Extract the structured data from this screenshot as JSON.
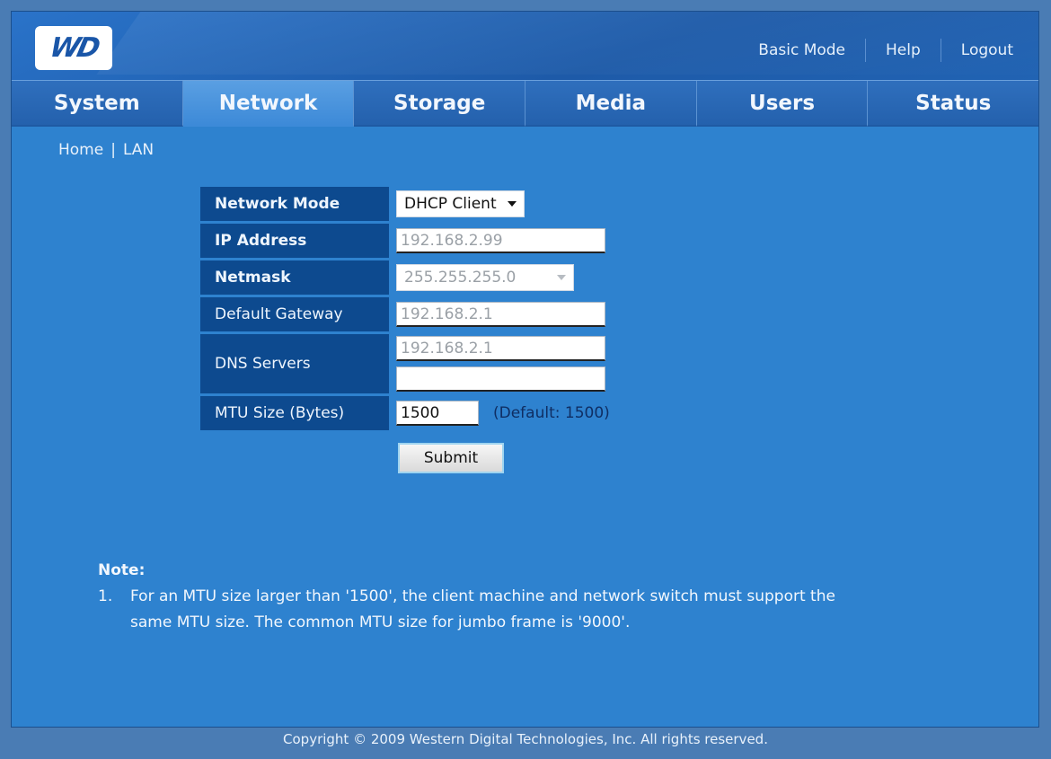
{
  "header": {
    "logo_text": "WD",
    "links": [
      "Basic Mode",
      "Help",
      "Logout"
    ]
  },
  "tabs": [
    {
      "label": "System",
      "active": false
    },
    {
      "label": "Network",
      "active": true
    },
    {
      "label": "Storage",
      "active": false
    },
    {
      "label": "Media",
      "active": false
    },
    {
      "label": "Users",
      "active": false
    },
    {
      "label": "Status",
      "active": false
    }
  ],
  "breadcrumb": {
    "home": "Home",
    "separator": "|",
    "current": "LAN"
  },
  "form": {
    "network_mode": {
      "label": "Network Mode",
      "value": "DHCP Client"
    },
    "ip_address": {
      "label": "IP Address",
      "value": "192.168.2.99"
    },
    "netmask": {
      "label": "Netmask",
      "value": "255.255.255.0"
    },
    "gateway": {
      "label": "Default Gateway",
      "value": "192.168.2.1"
    },
    "dns": {
      "label": "DNS Servers",
      "primary": "192.168.2.1",
      "secondary": ""
    },
    "mtu": {
      "label": "MTU Size (Bytes)",
      "value": "1500",
      "hint": "(Default: 1500)"
    },
    "submit_label": "Submit"
  },
  "note": {
    "title": "Note:",
    "items": [
      {
        "num": "1.",
        "text": "For an MTU size larger than '1500', the client machine and network switch must support the",
        "text2": "same MTU size. The common MTU size for jumbo frame is '9000'."
      }
    ]
  },
  "footer": {
    "copyright": "Copyright © 2009 Western Digital Technologies, Inc. All rights reserved."
  }
}
